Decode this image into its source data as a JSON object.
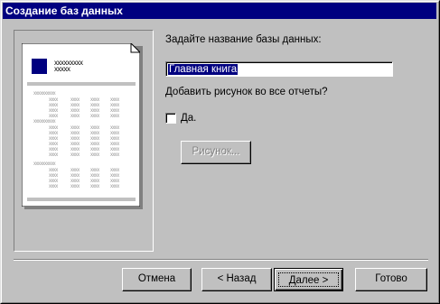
{
  "window": {
    "title": "Создание баз данных"
  },
  "preview": {
    "header_line1": "xxxxxxxxx",
    "header_line2": "xxxxx",
    "group_heading": "xxxxxxxxxx",
    "cell": "xxxx"
  },
  "form": {
    "name_label": "Задайте название базы данных:",
    "name_value": "Главная книга",
    "picture_question": "Добавить рисунок во все отчеты?",
    "checkbox_label": "Да.",
    "checkbox_checked": false,
    "picture_button": "Рисунок..."
  },
  "buttons": {
    "cancel": "Отмена",
    "back": "< Назад",
    "next": "Далее >",
    "finish": "Готово"
  }
}
